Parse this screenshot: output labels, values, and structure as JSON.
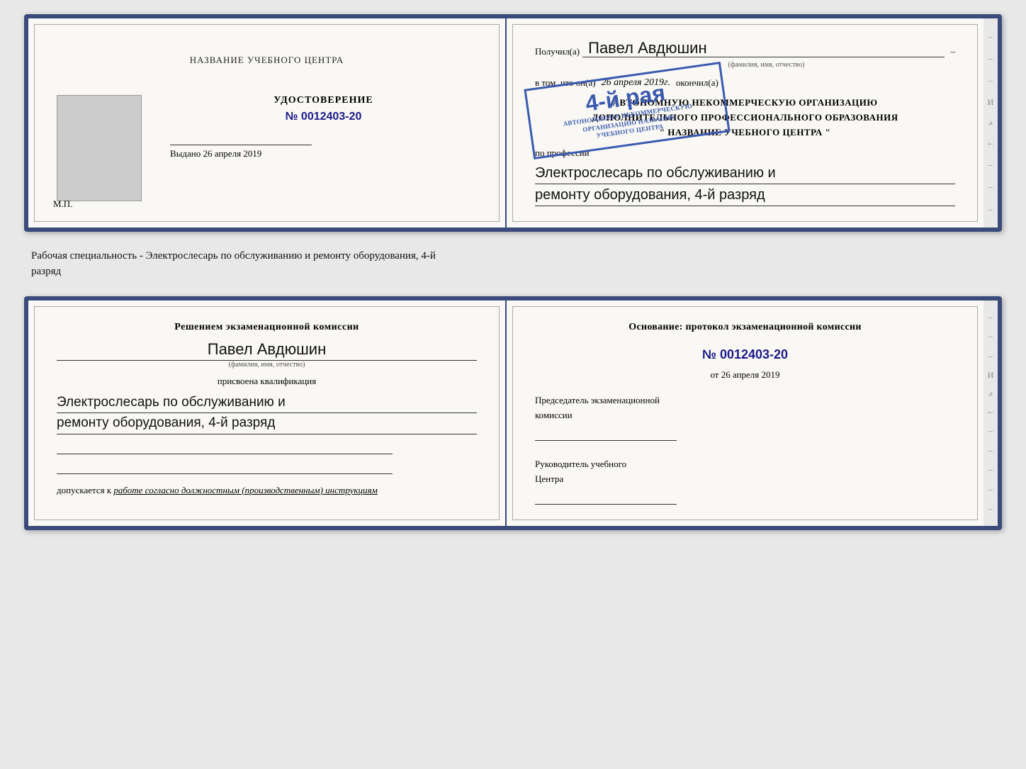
{
  "topBooklet": {
    "leftPage": {
      "centerTitle": "НАЗВАНИЕ УЧЕБНОГО ЦЕНТРА",
      "udostLabel": "УДОСТОВЕРЕНИЕ",
      "number": "№ 0012403-20",
      "issuedLabel": "Выдано",
      "issuedDate": "26 апреля 2019",
      "mpLabel": "М.П."
    },
    "rightPage": {
      "receivedLabel": "Получил(а)",
      "recipientName": "Павел Авдюшин",
      "fioLabel": "(фамилия, имя, отчество)",
      "vtomLabel": "в том, что он(а)",
      "date": "26 апреля 2019г.",
      "finishedLabel": "окончил(а)",
      "orgLine1": "АВТОНОМНУЮ НЕКОММЕРЧЕСКУЮ ОРГАНИЗАЦИЮ",
      "orgLine2": "ДОПОЛНИТЕЛЬНОГО ПРОФЕССИОНАЛЬНОГО ОБРАЗОВАНИЯ",
      "orgLine3": "\" НАЗВАНИЕ УЧЕБНОГО ЦЕНТРА \"",
      "poProfessiiLabel": "по профессии",
      "professionLine1": "Электрослесарь по обслуживанию и",
      "professionLine2": "ремонту оборудования, 4-й разряд"
    },
    "stamp": {
      "bigText": "4-й рая",
      "line1": "АВТОНОМНОМУ НЕКОММЕРЧЕСКУЮ",
      "line2": "ОРГАНИЗАЦИЮ НАЗВАНИЕ",
      "line3": "УЧЕБНОГО ЦЕНТРА"
    }
  },
  "middleText": {
    "line1": "Рабочая специальность - Электрослесарь по обслуживанию и ремонту оборудования, 4-й",
    "line2": "разряд"
  },
  "bottomBooklet": {
    "leftPage": {
      "decisionTitle": "Решением экзаменационной комиссии",
      "personName": "Павел Авдюшин",
      "fioLabel": "(фамилия, имя, отчество)",
      "prisvLabel": "присвоена квалификация",
      "qualLine1": "Электрослесарь по обслуживанию и",
      "qualLine2": "ремонту оборудования, 4-й разряд",
      "dopLabel": "допускается к",
      "dopItalic": "работе согласно должностным (производственным) инструкциям"
    },
    "rightPage": {
      "osnovLabel": "Основание: протокол экзаменационной комиссии",
      "protocolNum": "№ 0012403-20",
      "otLabel": "от",
      "otDate": "26 апреля 2019",
      "chairmanLine1": "Председатель экзаменационной",
      "chairmanLine2": "комиссии",
      "rukovLine1": "Руководитель учебного",
      "rukovLine2": "Центра"
    }
  },
  "edgeMarks": {
    "items": [
      "–",
      "–",
      "–",
      "И",
      "ᵢа",
      "←",
      "–",
      "–",
      "–",
      "–",
      "–"
    ]
  }
}
